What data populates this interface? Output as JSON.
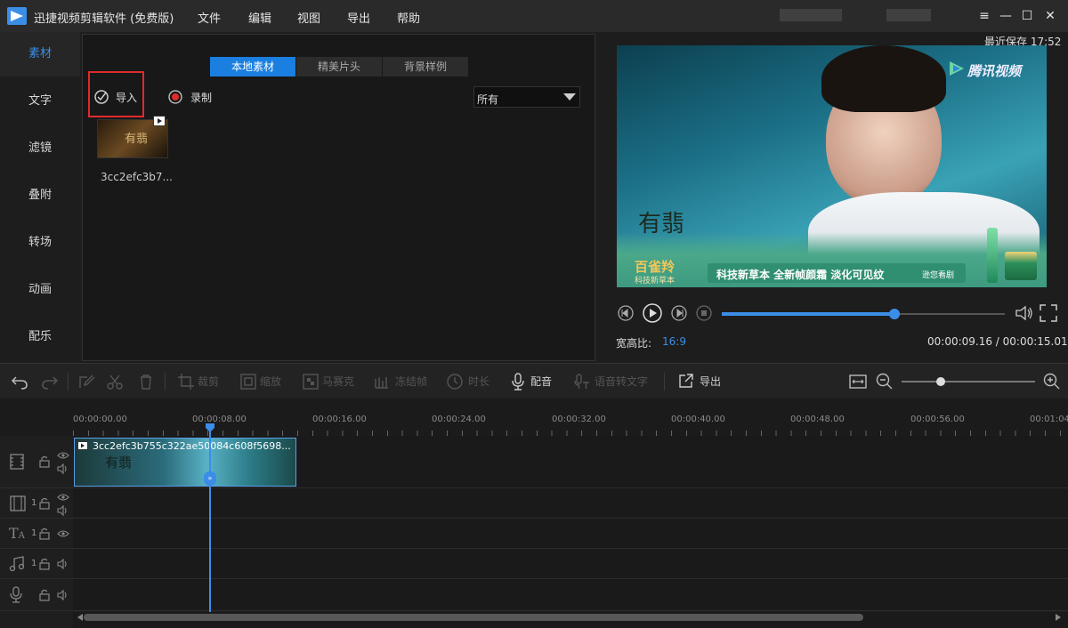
{
  "app": {
    "title": "迅捷视频剪辑软件 (免费版)",
    "menus": [
      "文件",
      "编辑",
      "视图",
      "导出",
      "帮助"
    ],
    "window_buttons": [
      "≡",
      "—",
      "☐",
      "✕"
    ]
  },
  "sidebar": {
    "items": [
      "素材",
      "文字",
      "滤镜",
      "叠附",
      "转场",
      "动画",
      "配乐"
    ],
    "active": 0
  },
  "media": {
    "tabs": [
      "本地素材",
      "精美片头",
      "背景样例"
    ],
    "import_label": "导入",
    "record_label": "录制",
    "filter_value": "所有",
    "items": [
      {
        "name": "3cc2efc3b7..."
      }
    ]
  },
  "preview": {
    "last_saved": "最近保存 17:52",
    "watermark": "腾讯视频",
    "aspect_label": "宽高比:",
    "aspect_value": "16:9",
    "time": "00:00:09.16 / 00:00:15.01",
    "progress": 0.61,
    "ad_title": "百雀羚",
    "ad_sub": "科技新草本",
    "ad_text": "科技新草本 全新帧颜霜 淡化可见纹",
    "ad_small": "逊您看剧"
  },
  "toolbar": {
    "items": [
      "裁剪",
      "缩放",
      "马赛克",
      "冻结帧",
      "时长",
      "配音",
      "语音转文字",
      "导出"
    ]
  },
  "timeline": {
    "ticks": [
      "00:00:00.00",
      "00:00:08.00",
      "00:00:16.00",
      "00:00:24.00",
      "00:00:32.00",
      "00:00:40.00",
      "00:00:48.00",
      "00:00:56.00",
      "00:01:04"
    ],
    "clip_name": "3cc2efc3b755c322ae50084c608f5698...",
    "track_nums": [
      "1",
      "1",
      "1"
    ]
  },
  "colors": {
    "accent": "#3b8ee8",
    "highlight": "#e02b2b"
  }
}
